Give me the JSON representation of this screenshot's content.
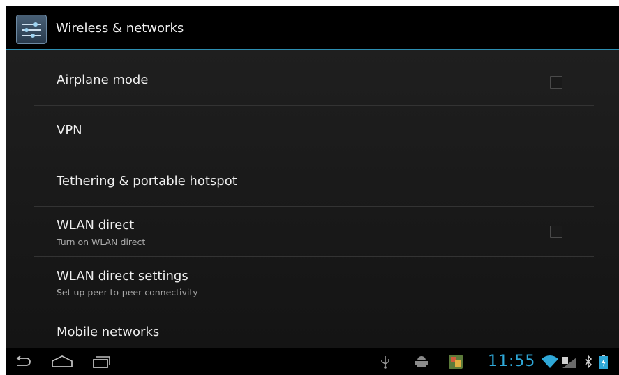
{
  "action_bar": {
    "title": "Wireless & networks",
    "icon": "settings-sliders-icon"
  },
  "settings": [
    {
      "title": "Airplane mode",
      "has_checkbox": true,
      "checked": false
    },
    {
      "title": "VPN"
    },
    {
      "title": "Tethering & portable hotspot"
    },
    {
      "title": "WLAN direct",
      "subtitle": "Turn on WLAN direct",
      "has_checkbox": true,
      "checked": false
    },
    {
      "title": "WLAN direct settings",
      "subtitle": "Set up peer-to-peer connectivity"
    },
    {
      "title": "Mobile networks"
    }
  ],
  "status_bar": {
    "time": "11:55",
    "icons": [
      "back-icon",
      "home-icon",
      "recent-apps-icon",
      "usb-icon",
      "android-debug-icon",
      "gallery-notification-icon",
      "wifi-icon",
      "signal-icon",
      "bluetooth-icon",
      "battery-icon"
    ],
    "accent_color": "#2fa8d8"
  },
  "colors": {
    "accent": "#2d8fb2",
    "background": "#000000",
    "list_background": "#1c1c1c"
  }
}
